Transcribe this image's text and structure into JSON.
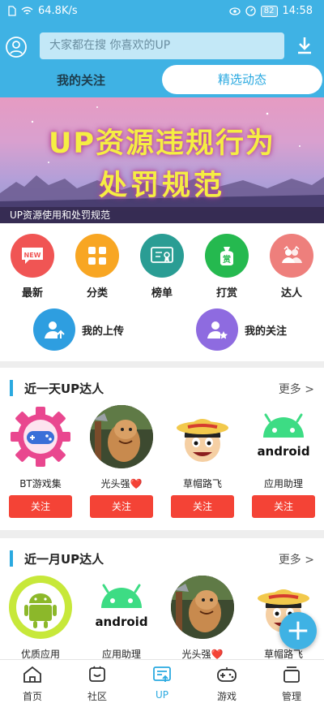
{
  "status": {
    "speed": "64.8K/s",
    "battery": "82",
    "time": "14:58"
  },
  "search": {
    "placeholder": "大家都在搜  你喜欢的UP"
  },
  "tabs": {
    "left": "我的关注",
    "right": "精选动态"
  },
  "banner": {
    "line1": "UP资源违规行为",
    "line2": "处罚规范",
    "caption": "UP资源使用和处罚规范"
  },
  "menu": {
    "items": [
      {
        "label": "最新",
        "color": "#f05554",
        "icon": "new-icon"
      },
      {
        "label": "分类",
        "color": "#f8a623",
        "icon": "grid-icon"
      },
      {
        "label": "榜单",
        "color": "#2a9d94",
        "icon": "certificate-icon"
      },
      {
        "label": "打赏",
        "color": "#25b94f",
        "icon": "reward-bag-icon"
      },
      {
        "label": "达人",
        "color": "#ee7f7c",
        "icon": "users-icon"
      }
    ],
    "row2": [
      {
        "label": "我的上传",
        "color": "#2e9ee0",
        "icon": "upload-user-icon"
      },
      {
        "label": "我的关注",
        "color": "#8e6be0",
        "icon": "star-user-icon"
      }
    ]
  },
  "section_day": {
    "title": "近一天UP达人",
    "more": "更多 >",
    "cards": [
      {
        "name": "BT游戏集",
        "follow": "关注"
      },
      {
        "name": "光头强❤️",
        "follow": "关注"
      },
      {
        "name": "草帽路飞",
        "follow": "关注"
      },
      {
        "name": "应用助理",
        "follow": "关注"
      }
    ]
  },
  "section_month": {
    "title": "近一月UP达人",
    "more": "更多 >",
    "cards": [
      {
        "name": "优质应用"
      },
      {
        "name": "应用助理"
      },
      {
        "name": "光头强❤️"
      },
      {
        "name": "草帽路飞"
      }
    ]
  },
  "nav": [
    {
      "label": "首页",
      "icon": "home-icon"
    },
    {
      "label": "社区",
      "icon": "community-icon"
    },
    {
      "label": "UP",
      "icon": "up-icon"
    },
    {
      "label": "游戏",
      "icon": "gamepad-icon"
    },
    {
      "label": "管理",
      "icon": "manage-icon"
    }
  ],
  "fab": {
    "label": "+"
  },
  "colors": {
    "primary": "#3fb2e4",
    "accent": "#2aa9e0",
    "follow": "#f44336"
  }
}
